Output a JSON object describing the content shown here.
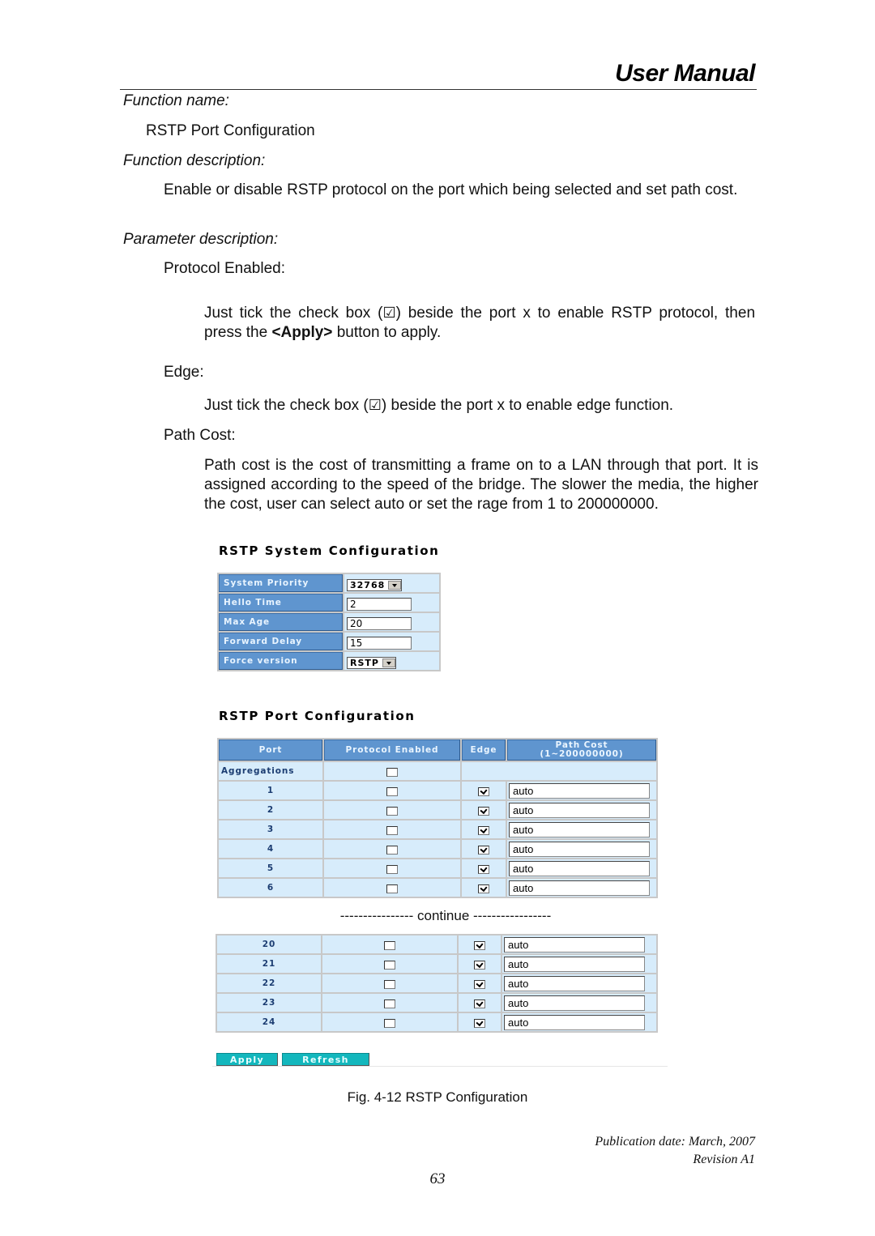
{
  "header": {
    "title": "User Manual"
  },
  "sections": {
    "function_name_label": "Function name:",
    "function_name": "RSTP Port Configuration",
    "function_description_label": "Function description:",
    "function_description": "Enable or disable RSTP protocol on the port which being selected and set path cost.",
    "parameter_description_label": "Parameter description:"
  },
  "params": {
    "protocol_enabled_label": "Protocol Enabled:",
    "protocol_enabled_text_1": "Just tick the check box (",
    "protocol_enabled_text_2": ") beside the port x to enable RSTP protocol, then press the ",
    "protocol_enabled_apply": "<Apply>",
    "protocol_enabled_text_3": " button to apply.",
    "edge_label": "Edge:",
    "edge_text_1": "Just tick the check box (",
    "edge_text_2": ") beside the port x to enable edge function.",
    "path_cost_label": "Path Cost:",
    "path_cost_text": "Path cost is the cost of transmitting a frame on to a LAN through that port. It is assigned according to the speed of the bridge. The slower the media, the higher the cost, user can select auto or set the rage from 1 to 200000000.",
    "checkbox_glyph": "☑"
  },
  "system_config": {
    "title": "RSTP System Configuration",
    "rows": [
      {
        "label": "System Priority",
        "type": "select",
        "value": "32768"
      },
      {
        "label": "Hello Time",
        "type": "input",
        "value": "2"
      },
      {
        "label": "Max Age",
        "type": "input",
        "value": "20"
      },
      {
        "label": "Forward Delay",
        "type": "input",
        "value": "15"
      },
      {
        "label": "Force version",
        "type": "select",
        "value": "RSTP"
      }
    ]
  },
  "port_config": {
    "title": "RSTP Port Configuration",
    "columns": [
      "Port",
      "Protocol Enabled",
      "Edge",
      "Path Cost",
      "(1~200000000)"
    ],
    "aggregations": {
      "label": "Aggregations",
      "protocol_enabled": false
    },
    "rows_top": [
      {
        "port": "1",
        "protocol_enabled": false,
        "edge": true,
        "path_cost": "auto"
      },
      {
        "port": "2",
        "protocol_enabled": false,
        "edge": true,
        "path_cost": "auto"
      },
      {
        "port": "3",
        "protocol_enabled": false,
        "edge": true,
        "path_cost": "auto"
      },
      {
        "port": "4",
        "protocol_enabled": false,
        "edge": true,
        "path_cost": "auto"
      },
      {
        "port": "5",
        "protocol_enabled": false,
        "edge": true,
        "path_cost": "auto"
      },
      {
        "port": "6",
        "protocol_enabled": false,
        "edge": true,
        "path_cost": "auto"
      }
    ],
    "continue_text": "---------------- continue -----------------",
    "rows_bottom": [
      {
        "port": "20",
        "protocol_enabled": false,
        "edge": true,
        "path_cost": "auto"
      },
      {
        "port": "21",
        "protocol_enabled": false,
        "edge": true,
        "path_cost": "auto"
      },
      {
        "port": "22",
        "protocol_enabled": false,
        "edge": true,
        "path_cost": "auto"
      },
      {
        "port": "23",
        "protocol_enabled": false,
        "edge": true,
        "path_cost": "auto"
      },
      {
        "port": "24",
        "protocol_enabled": false,
        "edge": true,
        "path_cost": "auto"
      }
    ],
    "apply_label": "Apply",
    "refresh_label": "Refresh"
  },
  "figure_caption": "Fig. 4-12 RSTP Configuration",
  "footer": {
    "publication": "Publication date: March, 2007",
    "revision": "Revision A1",
    "page_number": "63"
  }
}
